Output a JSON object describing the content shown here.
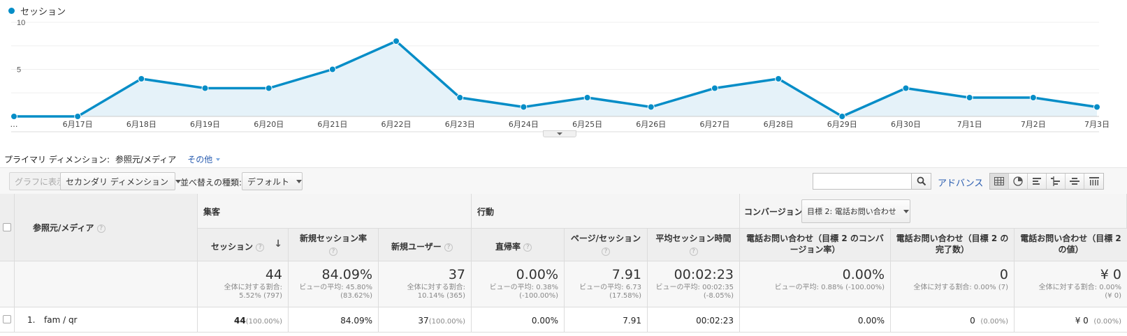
{
  "chart_data": {
    "type": "area",
    "legend": "セッション",
    "series": [
      {
        "name": "セッション",
        "values": [
          0,
          0,
          4,
          3,
          3,
          5,
          8,
          2,
          1,
          2,
          1,
          3,
          4,
          0,
          3,
          2,
          2,
          1
        ]
      }
    ],
    "categories": [
      "…",
      "6月17日",
      "6月18日",
      "6月19日",
      "6月20日",
      "6月21日",
      "6月22日",
      "6月23日",
      "6月24日",
      "6月25日",
      "6月26日",
      "6月27日",
      "6月28日",
      "6月29日",
      "6月30日",
      "7月1日",
      "7月2日",
      "7月3日"
    ],
    "y_ticks": [
      "10",
      "5"
    ],
    "ylim": [
      0,
      10
    ],
    "color": "#058dc7",
    "fill": "#e5f2f9"
  },
  "dimension": {
    "label": "プライマリ ディメンション:",
    "value": "参照元/メディア",
    "other": "その他"
  },
  "toolbar": {
    "plot_rows": "グラフに表示",
    "secondary_dimension": "セカンダリ ディメンション",
    "sort_label": "並べ替えの種類:",
    "sort_value": "デフォルト",
    "search_value": "",
    "advanced": "アドバンス"
  },
  "table": {
    "dim_header": "参照元/メディア",
    "groups": {
      "acquisition": "集客",
      "behavior": "行動",
      "conversions": "コンバージョン",
      "goal_select": "目標 2: 電話お問い合わせ"
    },
    "columns": {
      "sessions": "セッション",
      "new_session_rate": "新規セッション率",
      "new_users": "新規ユーザー",
      "bounce_rate": "直帰率",
      "pages_per_session": "ページ/セッション",
      "avg_duration": "平均セッション時間",
      "goal_conv_rate": "電話お問い合わせ（目標 2 のコンバージョン率）",
      "goal_completions": "電話お問い合わせ（目標 2 の完了数）",
      "goal_value": "電話お問い合わせ（目標 2 の値）"
    },
    "totals": {
      "sessions": "44",
      "sessions_sub1": "全体に対する割合:",
      "sessions_sub2": "5.52% (797)",
      "new_session_rate": "84.09%",
      "new_session_rate_sub1": "ビューの平均: 45.80%",
      "new_session_rate_sub2": "(83.62%)",
      "new_users": "37",
      "new_users_sub1": "全体に対する割合:",
      "new_users_sub2": "10.14% (365)",
      "bounce_rate": "0.00%",
      "bounce_rate_sub1": "ビューの平均: 0.38%",
      "bounce_rate_sub2": "(-100.00%)",
      "pages_per_session": "7.91",
      "pages_per_session_sub1": "ビューの平均: 6.73",
      "pages_per_session_sub2": "(17.58%)",
      "avg_duration": "00:02:23",
      "avg_duration_sub1": "ビューの平均: 00:02:35",
      "avg_duration_sub2": "(-8.05%)",
      "goal_conv_rate": "0.00%",
      "goal_conv_rate_sub1": "ビューの平均: 0.88% (-100.00%)",
      "goal_completions": "0",
      "goal_completions_sub1": "全体に対する割合: 0.00% (7)",
      "goal_value": "¥ 0",
      "goal_value_sub1": "全体に対する割合: 0.00%",
      "goal_value_sub2": "(¥ 0)"
    },
    "rows": [
      {
        "index": "1.",
        "name": "fam / qr",
        "sessions": "44",
        "sessions_pct": "(100.00%)",
        "new_session_rate": "84.09%",
        "new_users": "37",
        "new_users_pct": "(100.00%)",
        "bounce_rate": "0.00%",
        "pages_per_session": "7.91",
        "avg_duration": "00:02:23",
        "goal_conv_rate": "0.00%",
        "goal_completions": "0",
        "goal_completions_pct": "(0.00%)",
        "goal_value": "¥ 0",
        "goal_value_pct": "(0.00%)"
      }
    ]
  }
}
